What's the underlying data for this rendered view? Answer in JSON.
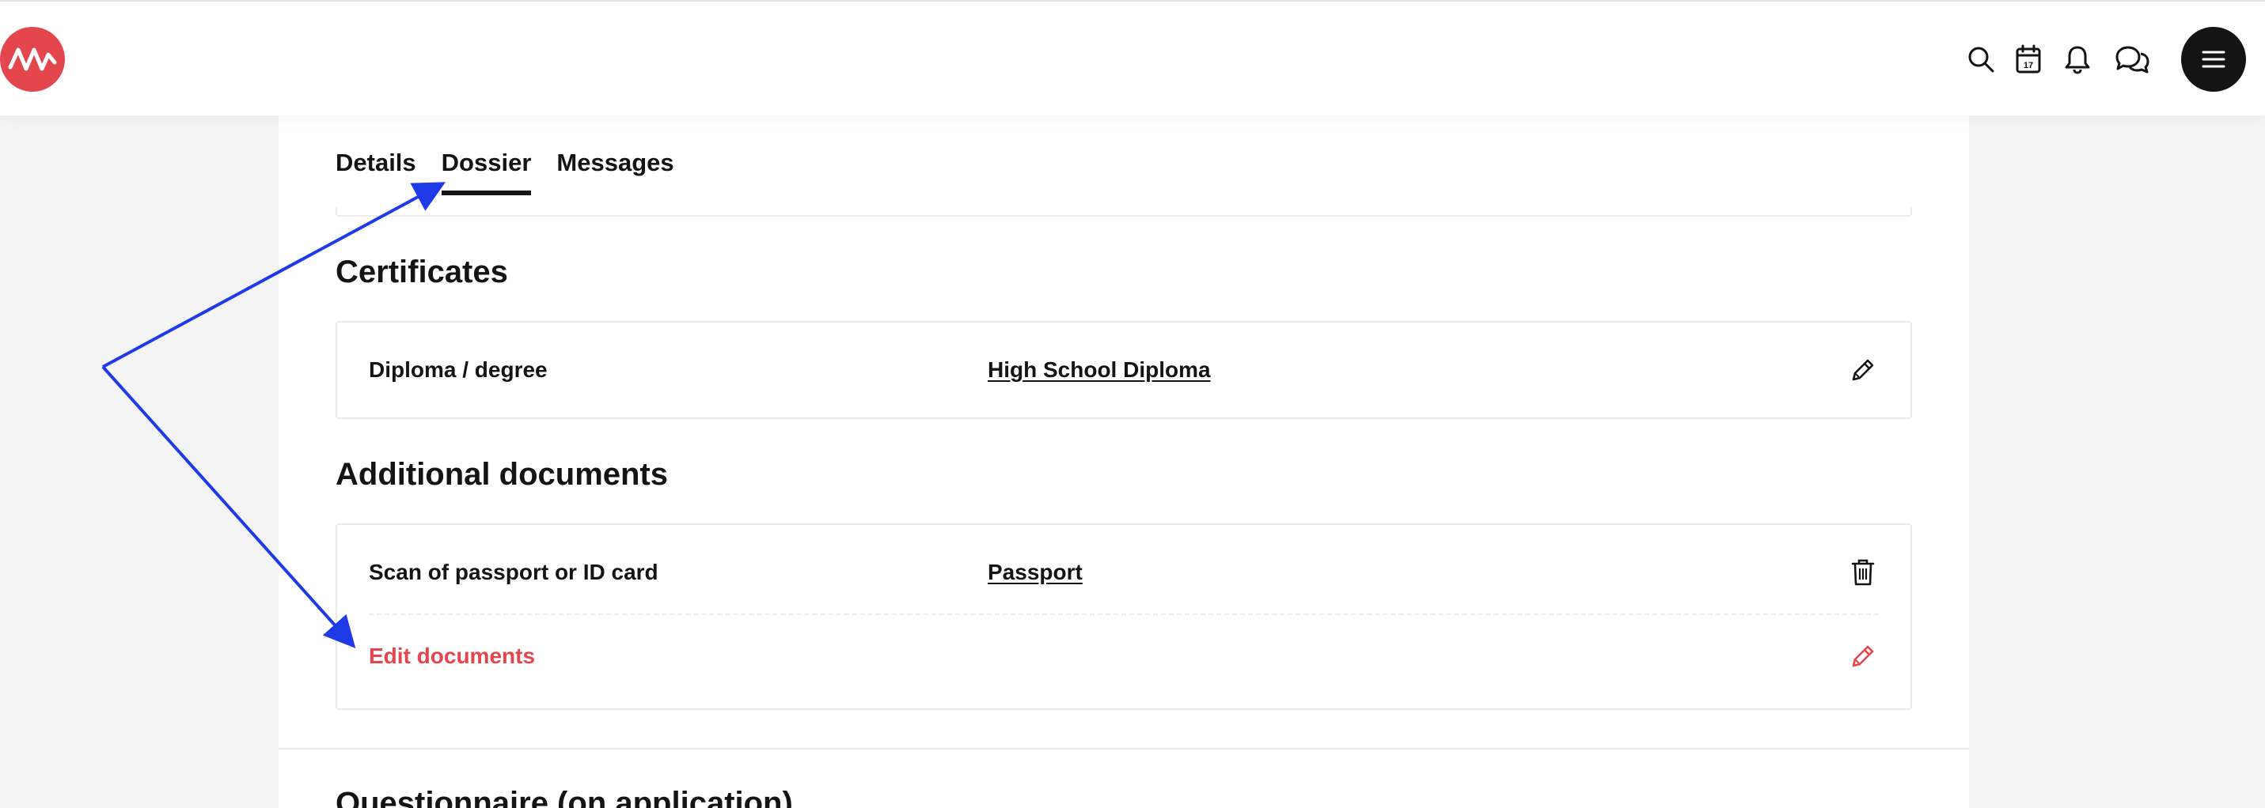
{
  "header": {
    "icons": [
      "logo-wave-icon",
      "search-icon",
      "calendar-icon",
      "bell-icon",
      "chat-icon",
      "hamburger-menu-icon"
    ],
    "calendar_day": "17",
    "brand_color": "#e4464d"
  },
  "tabs": [
    {
      "label": "Details"
    },
    {
      "label": "Dossier"
    },
    {
      "label": "Messages"
    }
  ],
  "active_tab": "Dossier",
  "certificates": {
    "title": "Certificates",
    "rows": [
      {
        "label": "Diploma / degree",
        "value": "High School Diploma",
        "action_icon": "pencil-icon"
      }
    ]
  },
  "additional_documents": {
    "title": "Additional documents",
    "rows": [
      {
        "label": "Scan of passport or ID card",
        "value": "Passport",
        "action_icon": "trash-icon"
      }
    ],
    "edit_label": "Edit documents",
    "edit_icon": "pencil-icon"
  },
  "next_section": {
    "title": "Questionnaire (on application)"
  },
  "annotation": {
    "color": "#1f3ae8"
  }
}
